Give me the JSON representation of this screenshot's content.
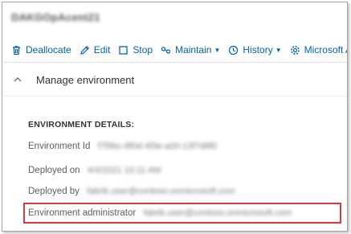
{
  "header": {
    "title": "DAKGOpAcent21"
  },
  "toolbar": {
    "items": [
      {
        "label": "Deallocate",
        "icon": "trash-icon"
      },
      {
        "label": "Edit",
        "icon": "pencil-icon"
      },
      {
        "label": "Stop",
        "icon": "stop-square-icon"
      },
      {
        "label": "Maintain",
        "icon": "maintain-icon",
        "has_dropdown": true
      },
      {
        "label": "History",
        "icon": "clock-icon",
        "has_dropdown": true
      },
      {
        "label": "Microsoft Azure s",
        "icon": "gear-icon"
      }
    ]
  },
  "section": {
    "title": "Manage environment",
    "expanded": true
  },
  "details": {
    "heading": "ENVIRONMENT DETAILS:",
    "rows": [
      {
        "label": "Environment Id",
        "value": "f7f9bc-8f0d-4f3e-a00-13f7d8f0"
      },
      {
        "label": "Deployed on",
        "value": "4/4/2021 10:11 AM"
      },
      {
        "label": "Deployed by",
        "value": "fabrik.user@contoso.onmicrosoft.com"
      },
      {
        "label": "Environment administrator",
        "value": "fabrik.user@contoso.onmicrosoft.com"
      }
    ],
    "highlighted_row": "Environment administrator"
  },
  "colors": {
    "link_blue": "#0063b1",
    "highlight_red": "#d83b3b"
  }
}
